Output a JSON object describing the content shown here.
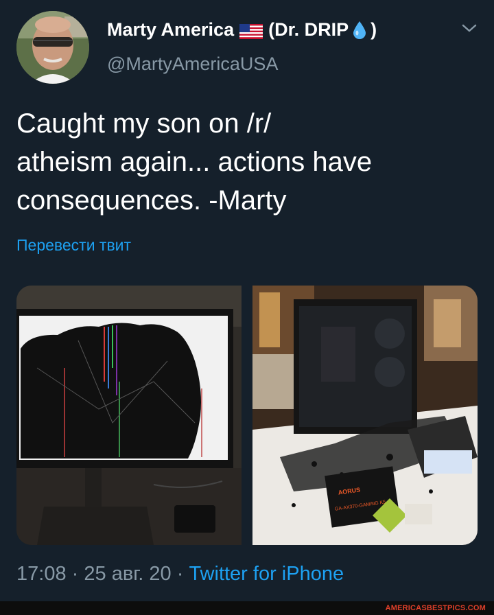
{
  "author": {
    "name": "Marty America",
    "name_suffix": "(Dr. DRIP",
    "name_close": ")",
    "handle": "@MartyAmericaUSA",
    "flag_icon": "us-flag-emoji",
    "drop_icon": "droplet-emoji"
  },
  "tweet": {
    "text": "Caught my son on /r/\natheism again... actions have\nconsequences. -Marty",
    "translate_label": "Перевести твит"
  },
  "meta": {
    "time": "17:08",
    "separator": "·",
    "date": "25 авг. 20",
    "source": "Twitter for iPhone"
  },
  "media": {
    "photo1": "smashed-monitor-photo",
    "photo2": "smashed-pc-case-photo",
    "box_label_line1": "AORUS",
    "box_label_line2": "GA-AX370-GAMING K5"
  },
  "watermark": "AMERICASBESTPICS.COM",
  "colors": {
    "background": "#15202b",
    "text": "#ffffff",
    "secondary": "#8899a6",
    "accent": "#1da1f2"
  }
}
